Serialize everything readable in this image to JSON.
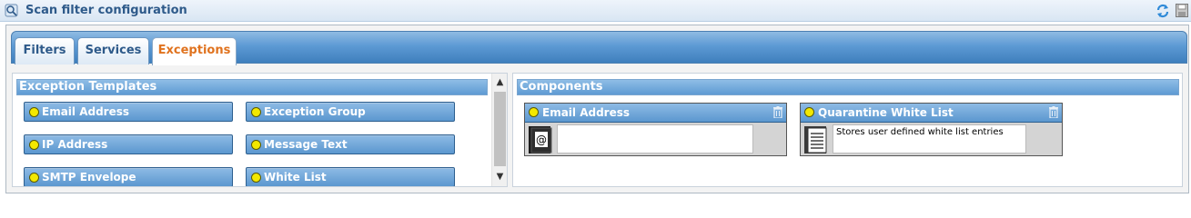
{
  "window": {
    "title": "Scan filter configuration",
    "icons": [
      "scan-filter-icon",
      "refresh-icon",
      "save-icon"
    ]
  },
  "tabs": [
    {
      "label": "Filters",
      "active": false
    },
    {
      "label": "Services",
      "active": false
    },
    {
      "label": "Exceptions",
      "active": true
    }
  ],
  "exception_templates": {
    "header": "Exception  Templates",
    "items": [
      {
        "label": "Email Address"
      },
      {
        "label": "Exception Group"
      },
      {
        "label": "IP Address"
      },
      {
        "label": "Message Text"
      },
      {
        "label": "SMTP Envelope"
      },
      {
        "label": "White List"
      }
    ]
  },
  "components": {
    "header": "Components",
    "items": [
      {
        "title": "Email Address",
        "icon": "at-sign-icon",
        "description": ""
      },
      {
        "title": "Quarantine White List",
        "icon": "list-document-icon",
        "description": "Stores user defined white list entries"
      }
    ]
  },
  "colors": {
    "accent_tab_text": "#e0731f",
    "header_blue": "#5e9bd3",
    "status_dot": "#f3e800"
  }
}
